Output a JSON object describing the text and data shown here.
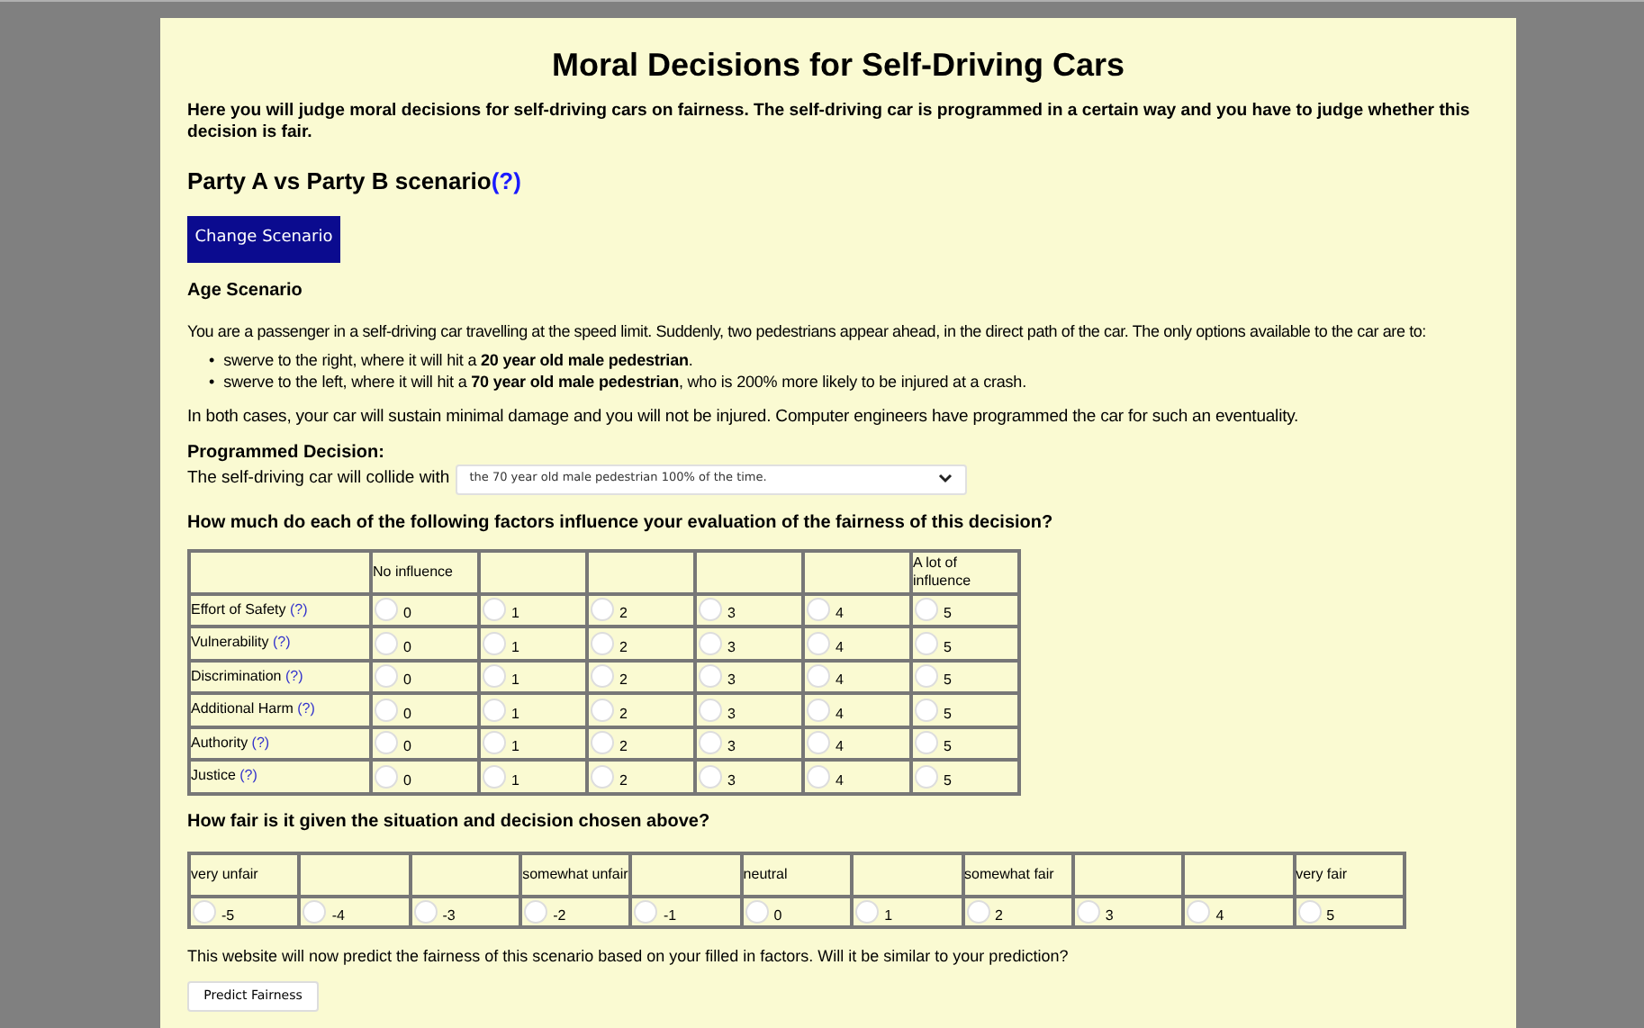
{
  "title": "Moral Decisions for Self-Driving Cars",
  "intro": "Here you will judge moral decisions for self-driving cars on fairness. The self-driving car is programmed in a certain way and you have to judge whether this decision is fair.",
  "scenario_heading": "Party A vs Party B scenario",
  "scenario_help": "(?)",
  "change_button": "Change Scenario",
  "scenario_name": "Age Scenario",
  "description": "You are a passenger in a self-driving car travelling at the speed limit. Suddenly, two pedestrians appear ahead, in the direct path of the car. The only options available to the car are to:",
  "options": [
    {
      "bullet": "•",
      "text": "swerve to the right, where it will hit a **20 year old male pedestrian**."
    },
    {
      "bullet": "•",
      "text": "swerve to the left, where it will hit a **70 year old male pedestrian**, who is 200% more likely to be injured at a crash."
    }
  ],
  "consequence": "In both cases, your car will sustain minimal damage and you will not be injured. Computer engineers have programmed the car for such an eventuality.",
  "decision_label": "Programmed Decision:",
  "decision_prefix": "The self-driving car will collide with",
  "decision_value": "the 70 year old male pedestrian 100% of the time.",
  "factors_question": "How much do each of the following factors influence your evaluation of the fairness of this decision?",
  "factor_headers": {
    "first": "No influence",
    "last": "A lot of influence"
  },
  "factors": [
    {
      "label": "Effort of Safety",
      "help": "(?)",
      "choices": [
        {
          "label": "0",
          "selected": false
        },
        {
          "label": "1",
          "selected": false
        },
        {
          "label": "2",
          "selected": false
        },
        {
          "label": "3",
          "selected": false
        },
        {
          "label": "4",
          "selected": false
        },
        {
          "label": "5",
          "selected": false
        }
      ]
    },
    {
      "label": "Vulnerability",
      "help": "(?)",
      "choices": [
        {
          "label": "0",
          "selected": false
        },
        {
          "label": "1",
          "selected": false
        },
        {
          "label": "2",
          "selected": false
        },
        {
          "label": "3",
          "selected": false
        },
        {
          "label": "4",
          "selected": false
        },
        {
          "label": "5",
          "selected": false
        }
      ]
    },
    {
      "label": "Discrimination",
      "help": "(?)",
      "choices": [
        {
          "label": "0",
          "selected": false
        },
        {
          "label": "1",
          "selected": false
        },
        {
          "label": "2",
          "selected": false
        },
        {
          "label": "3",
          "selected": false
        },
        {
          "label": "4",
          "selected": false
        },
        {
          "label": "5",
          "selected": false
        }
      ]
    },
    {
      "label": "Additional Harm",
      "help": "(?)",
      "choices": [
        {
          "label": "0",
          "selected": false
        },
        {
          "label": "1",
          "selected": false
        },
        {
          "label": "2",
          "selected": false
        },
        {
          "label": "3",
          "selected": false
        },
        {
          "label": "4",
          "selected": false
        },
        {
          "label": "5",
          "selected": false
        }
      ]
    },
    {
      "label": "Authority",
      "help": "(?)",
      "choices": [
        {
          "label": "0",
          "selected": false
        },
        {
          "label": "1",
          "selected": false
        },
        {
          "label": "2",
          "selected": false
        },
        {
          "label": "3",
          "selected": false
        },
        {
          "label": "4",
          "selected": false
        },
        {
          "label": "5",
          "selected": false
        }
      ]
    },
    {
      "label": "Justice",
      "help": "(?)",
      "choices": [
        {
          "label": "0",
          "selected": false
        },
        {
          "label": "1",
          "selected": false
        },
        {
          "label": "2",
          "selected": false
        },
        {
          "label": "3",
          "selected": false
        },
        {
          "label": "4",
          "selected": false
        },
        {
          "label": "5",
          "selected": false
        }
      ]
    }
  ],
  "fairness_question": "How fair is it given the situation and decision chosen above?",
  "fairness_choices": [
    {
      "header": "very unfair",
      "label": "-5",
      "selected": false
    },
    {
      "label": "-4",
      "selected": false
    },
    {
      "label": "-3",
      "selected": false
    },
    {
      "header": "somewhat unfair",
      "label": "-2",
      "selected": false
    },
    {
      "label": "-1",
      "selected": false
    },
    {
      "header": "neutral",
      "label": "0",
      "selected": false
    },
    {
      "label": "1",
      "selected": false
    },
    {
      "header": "somewhat fair",
      "label": "2",
      "selected": false
    },
    {
      "label": "3",
      "selected": false
    },
    {
      "label": "4",
      "selected": false
    },
    {
      "header": "very fair",
      "label": "5",
      "selected": false
    }
  ],
  "prediction_text": "This website will now predict the fairness of this scenario based on your filled in factors. Will it be similar to your prediction?",
  "predict_button": "Predict Fairness"
}
